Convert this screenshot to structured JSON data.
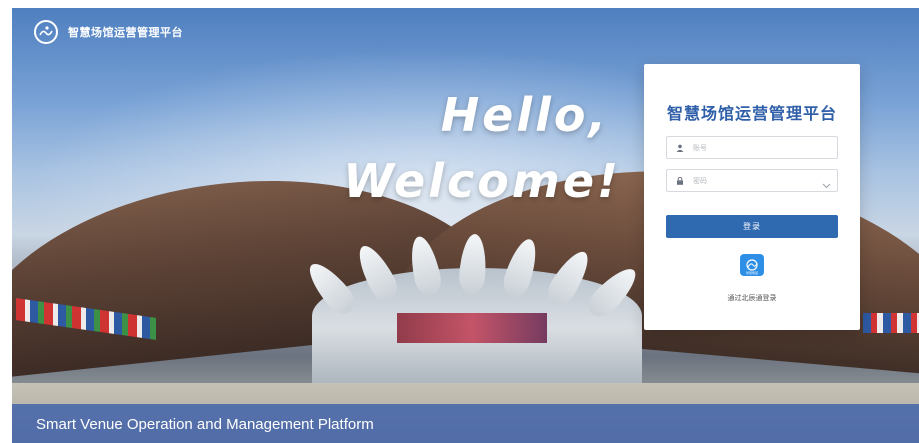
{
  "header": {
    "platform_title": "智慧场馆运营管理平台",
    "logo_icon": "runner-logo-icon"
  },
  "hero": {
    "line1": "Hello,",
    "line2": "Welcome!"
  },
  "footer": {
    "subtitle": "Smart Venue Operation and Management Platform"
  },
  "login": {
    "title": "智慧场馆运营管理平台",
    "username_placeholder": "账号",
    "password_placeholder": "密码",
    "submit_label": "登录",
    "app_icon_caption": "智慧场馆",
    "scan_hint": "通过北辰通登录"
  },
  "colors": {
    "accent": "#2f6ab0",
    "title": "#2f5fa8",
    "footer_band": "#3e60aa"
  }
}
